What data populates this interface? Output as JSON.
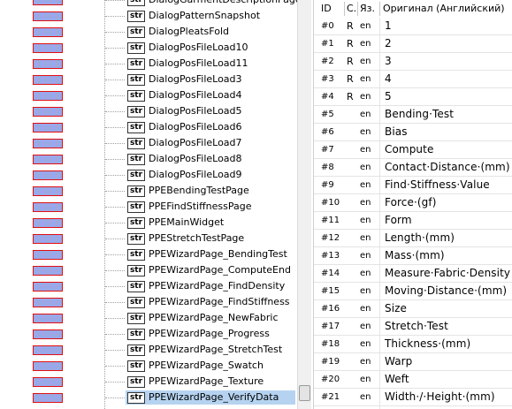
{
  "tree": {
    "items": [
      {
        "label": "DialogGarmentDescriptionPage"
      },
      {
        "label": "DialogPatternSnapshot"
      },
      {
        "label": "DialogPleatsFold"
      },
      {
        "label": "DialogPosFileLoad10"
      },
      {
        "label": "DialogPosFileLoad11"
      },
      {
        "label": "DialogPosFileLoad3"
      },
      {
        "label": "DialogPosFileLoad4"
      },
      {
        "label": "DialogPosFileLoad5"
      },
      {
        "label": "DialogPosFileLoad6"
      },
      {
        "label": "DialogPosFileLoad7"
      },
      {
        "label": "DialogPosFileLoad8"
      },
      {
        "label": "DialogPosFileLoad9"
      },
      {
        "label": "PPEBendingTestPage"
      },
      {
        "label": "PPEFindStiffnessPage"
      },
      {
        "label": "PPEMainWidget"
      },
      {
        "label": "PPEStretchTestPage"
      },
      {
        "label": "PPEWizardPage_BendingTest"
      },
      {
        "label": "PPEWizardPage_ComputeEnd"
      },
      {
        "label": "PPEWizardPage_FindDensity"
      },
      {
        "label": "PPEWizardPage_FindStiffness"
      },
      {
        "label": "PPEWizardPage_NewFabric"
      },
      {
        "label": "PPEWizardPage_Progress"
      },
      {
        "label": "PPEWizardPage_StretchTest"
      },
      {
        "label": "PPEWizardPage_Swatch"
      },
      {
        "label": "PPEWizardPage_Texture"
      },
      {
        "label": "PPEWizardPage_VerifyData"
      }
    ],
    "icon_text": "str",
    "selected_index": 25
  },
  "grid": {
    "headers": {
      "id": "ID",
      "c": "С.",
      "lang": "Яз.",
      "original": "Оригинал (Английский)"
    },
    "rows": [
      {
        "id": "#0",
        "c": "R",
        "lang": "en",
        "text": "1"
      },
      {
        "id": "#1",
        "c": "R",
        "lang": "en",
        "text": "2"
      },
      {
        "id": "#2",
        "c": "R",
        "lang": "en",
        "text": "3"
      },
      {
        "id": "#3",
        "c": "R",
        "lang": "en",
        "text": "4"
      },
      {
        "id": "#4",
        "c": "R",
        "lang": "en",
        "text": "5"
      },
      {
        "id": "#5",
        "c": "",
        "lang": "en",
        "text": "Bending·Test"
      },
      {
        "id": "#6",
        "c": "",
        "lang": "en",
        "text": "Bias"
      },
      {
        "id": "#7",
        "c": "",
        "lang": "en",
        "text": "Compute"
      },
      {
        "id": "#8",
        "c": "",
        "lang": "en",
        "text": "Contact·Distance·(mm)"
      },
      {
        "id": "#9",
        "c": "",
        "lang": "en",
        "text": "Find·Stiffness·Value"
      },
      {
        "id": "#10",
        "c": "",
        "lang": "en",
        "text": "Force·(gf)"
      },
      {
        "id": "#11",
        "c": "",
        "lang": "en",
        "text": "Form"
      },
      {
        "id": "#12",
        "c": "",
        "lang": "en",
        "text": "Length·(mm)"
      },
      {
        "id": "#13",
        "c": "",
        "lang": "en",
        "text": "Mass·(mm)"
      },
      {
        "id": "#14",
        "c": "",
        "lang": "en",
        "text": "Measure·Fabric·Density"
      },
      {
        "id": "#15",
        "c": "",
        "lang": "en",
        "text": "Moving·Distance·(mm)"
      },
      {
        "id": "#16",
        "c": "",
        "lang": "en",
        "text": "Size"
      },
      {
        "id": "#17",
        "c": "",
        "lang": "en",
        "text": "Stretch·Test"
      },
      {
        "id": "#18",
        "c": "",
        "lang": "en",
        "text": "Thickness·(mm)"
      },
      {
        "id": "#19",
        "c": "",
        "lang": "en",
        "text": "Warp"
      },
      {
        "id": "#20",
        "c": "",
        "lang": "en",
        "text": "Weft"
      },
      {
        "id": "#21",
        "c": "",
        "lang": "en",
        "text": "Width·/·Height·(mm)"
      }
    ]
  },
  "colors": {
    "bar_fill": "#9aa8e8",
    "bar_border": "#e01010",
    "selection": "#b5d3f0"
  }
}
